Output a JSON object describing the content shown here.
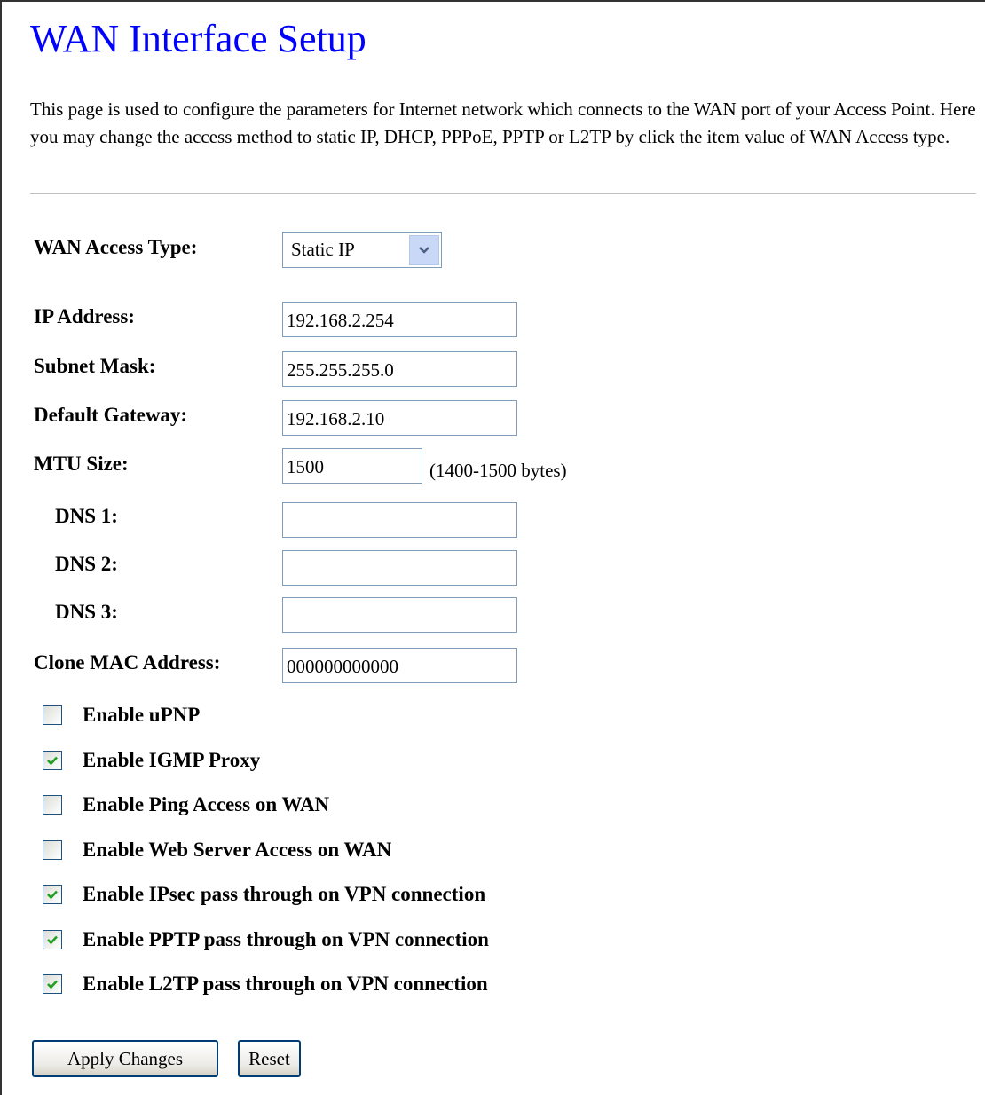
{
  "page": {
    "title": "WAN Interface Setup",
    "description": "This page is used to configure the parameters for Internet network which connects to the WAN port of your Access Point. Here you may change the access method to static IP, DHCP, PPPoE, PPTP or L2TP by click the item value of WAN Access type."
  },
  "form": {
    "wan_access_type": {
      "label": "WAN Access Type:",
      "value": "Static IP"
    },
    "ip_address": {
      "label": "IP Address:",
      "value": "192.168.2.254"
    },
    "subnet_mask": {
      "label": "Subnet Mask:",
      "value": "255.255.255.0"
    },
    "default_gateway": {
      "label": "Default Gateway:",
      "value": "192.168.2.10"
    },
    "mtu_size": {
      "label": "MTU Size:",
      "value": "1500",
      "hint": "(1400-1500 bytes)"
    },
    "dns1": {
      "label": "DNS 1:",
      "value": ""
    },
    "dns2": {
      "label": "DNS 2:",
      "value": ""
    },
    "dns3": {
      "label": "DNS 3:",
      "value": ""
    },
    "clone_mac": {
      "label": "Clone MAC Address:",
      "value": "000000000000"
    }
  },
  "options": [
    {
      "label": "Enable uPNP",
      "checked": false
    },
    {
      "label": "Enable IGMP Proxy",
      "checked": true
    },
    {
      "label": "Enable Ping Access on WAN",
      "checked": false
    },
    {
      "label": "Enable Web Server Access on WAN",
      "checked": false
    },
    {
      "label": "Enable IPsec pass through on VPN connection",
      "checked": true
    },
    {
      "label": "Enable PPTP pass through on VPN connection",
      "checked": true
    },
    {
      "label": "Enable L2TP pass through on VPN connection",
      "checked": true
    }
  ],
  "buttons": {
    "apply": "Apply Changes",
    "reset": "Reset"
  },
  "colors": {
    "title": "#0000ff",
    "check": "#21a121",
    "input_border": "#7f9db9",
    "button_border": "#003c74"
  },
  "icons": {
    "dropdown": "chevron-down-icon",
    "check": "checkmark-icon"
  }
}
